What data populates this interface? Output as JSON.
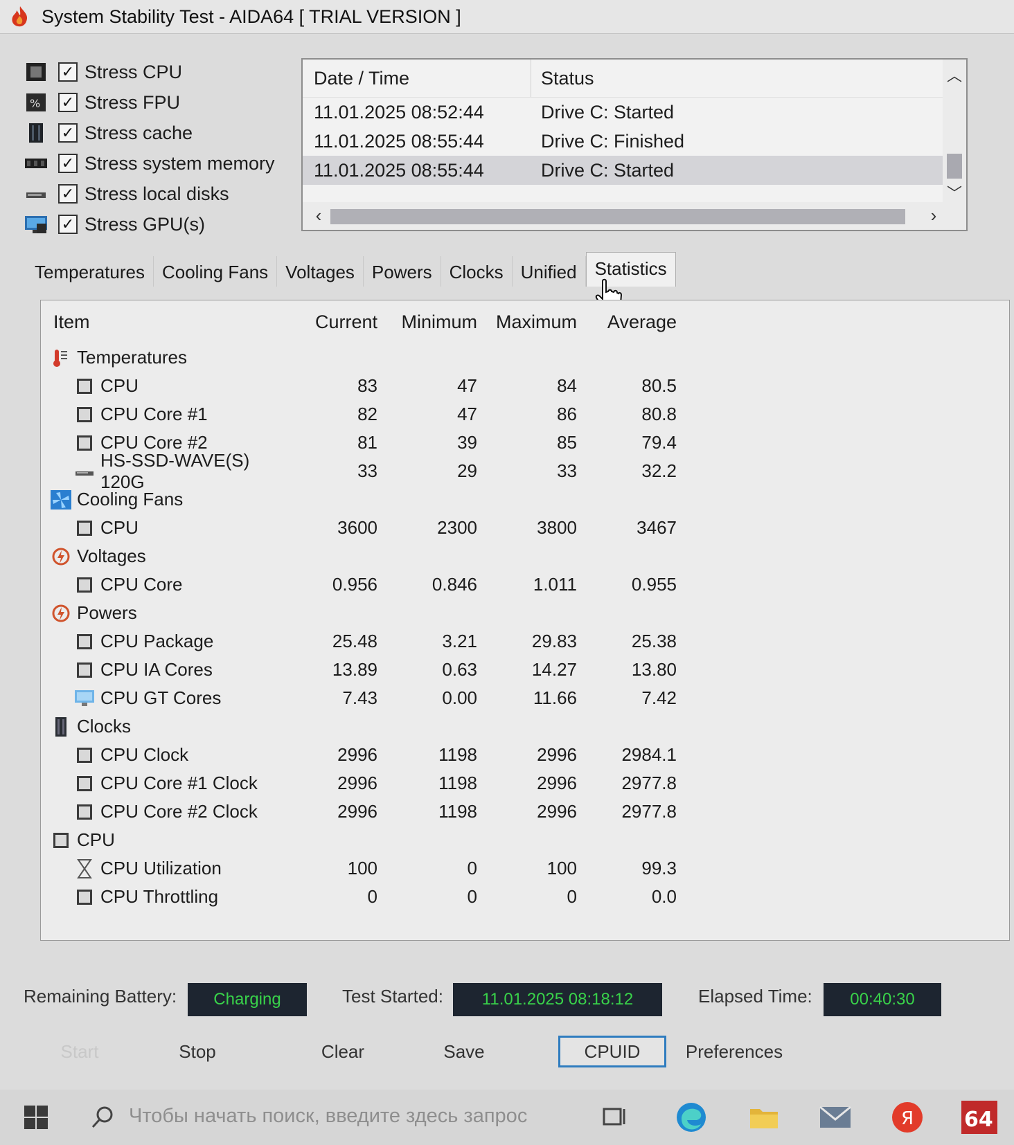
{
  "window": {
    "title": "System Stability Test - AIDA64  [ TRIAL VERSION ]"
  },
  "stress_options": [
    {
      "label": "Stress CPU",
      "checked": true,
      "icon": "cpu-chip-icon"
    },
    {
      "label": "Stress FPU",
      "checked": true,
      "icon": "fpu-icon"
    },
    {
      "label": "Stress cache",
      "checked": true,
      "icon": "cache-icon"
    },
    {
      "label": "Stress system memory",
      "checked": true,
      "icon": "memory-icon"
    },
    {
      "label": "Stress local disks",
      "checked": true,
      "icon": "disk-icon"
    },
    {
      "label": "Stress GPU(s)",
      "checked": true,
      "icon": "gpu-icon"
    }
  ],
  "log": {
    "columns": [
      "Date / Time",
      "Status"
    ],
    "rows": [
      {
        "time": "11.01.2025 08:52:44",
        "status": "Drive C: Started"
      },
      {
        "time": "11.01.2025 08:55:44",
        "status": "Drive C: Finished"
      },
      {
        "time": "11.01.2025 08:55:44",
        "status": "Drive C: Started"
      }
    ]
  },
  "tabs": [
    "Temperatures",
    "Cooling Fans",
    "Voltages",
    "Powers",
    "Clocks",
    "Unified",
    "Statistics"
  ],
  "active_tab": "Statistics",
  "stats": {
    "columns": [
      "Item",
      "Current",
      "Minimum",
      "Maximum",
      "Average"
    ],
    "groups": [
      {
        "name": "Temperatures",
        "icon": "thermometer-icon",
        "items": [
          {
            "name": "CPU",
            "icon": "chip-icon",
            "current": "83",
            "minimum": "47",
            "maximum": "84",
            "average": "80.5"
          },
          {
            "name": "CPU Core #1",
            "icon": "chip-icon",
            "current": "82",
            "minimum": "47",
            "maximum": "86",
            "average": "80.8"
          },
          {
            "name": "CPU Core #2",
            "icon": "chip-icon",
            "current": "81",
            "minimum": "39",
            "maximum": "85",
            "average": "79.4"
          },
          {
            "name": "HS-SSD-WAVE(S) 120G",
            "icon": "disk-icon",
            "current": "33",
            "minimum": "29",
            "maximum": "33",
            "average": "32.2"
          }
        ]
      },
      {
        "name": "Cooling Fans",
        "icon": "fan-icon",
        "items": [
          {
            "name": "CPU",
            "icon": "chip-icon",
            "current": "3600",
            "minimum": "2300",
            "maximum": "3800",
            "average": "3467"
          }
        ]
      },
      {
        "name": "Voltages",
        "icon": "voltage-icon",
        "items": [
          {
            "name": "CPU Core",
            "icon": "chip-icon",
            "current": "0.956",
            "minimum": "0.846",
            "maximum": "1.011",
            "average": "0.955"
          }
        ]
      },
      {
        "name": "Powers",
        "icon": "power-icon",
        "items": [
          {
            "name": "CPU Package",
            "icon": "chip-icon",
            "current": "25.48",
            "minimum": "3.21",
            "maximum": "29.83",
            "average": "25.38"
          },
          {
            "name": "CPU IA Cores",
            "icon": "chip-icon",
            "current": "13.89",
            "minimum": "0.63",
            "maximum": "14.27",
            "average": "13.80"
          },
          {
            "name": "CPU GT Cores",
            "icon": "monitor-icon",
            "current": "7.43",
            "minimum": "0.00",
            "maximum": "11.66",
            "average": "7.42"
          }
        ]
      },
      {
        "name": "Clocks",
        "icon": "clock-module-icon",
        "items": [
          {
            "name": "CPU Clock",
            "icon": "chip-icon",
            "current": "2996",
            "minimum": "1198",
            "maximum": "2996",
            "average": "2984.1"
          },
          {
            "name": "CPU Core #1 Clock",
            "icon": "chip-icon",
            "current": "2996",
            "minimum": "1198",
            "maximum": "2996",
            "average": "2977.8"
          },
          {
            "name": "CPU Core #2 Clock",
            "icon": "chip-icon",
            "current": "2996",
            "minimum": "1198",
            "maximum": "2996",
            "average": "2977.8"
          }
        ]
      },
      {
        "name": "CPU",
        "icon": "chip-icon",
        "items": [
          {
            "name": "CPU Utilization",
            "icon": "hourglass-icon",
            "current": "100",
            "minimum": "0",
            "maximum": "100",
            "average": "99.3"
          },
          {
            "name": "CPU Throttling",
            "icon": "chip-icon",
            "current": "0",
            "minimum": "0",
            "maximum": "0",
            "average": "0.0"
          }
        ]
      }
    ]
  },
  "status": {
    "battery_label": "Remaining Battery:",
    "battery_value": "Charging",
    "started_label": "Test Started:",
    "started_value": "11.01.2025 08:18:12",
    "elapsed_label": "Elapsed Time:",
    "elapsed_value": "00:40:30",
    "value_color": "#39d24a"
  },
  "buttons": {
    "start": "Start",
    "stop": "Stop",
    "clear": "Clear",
    "save": "Save",
    "cpuid": "CPUID",
    "preferences": "Preferences"
  },
  "taskbar": {
    "search_placeholder": "Чтобы начать поиск, введите здесь запрос",
    "aida_badge": "64",
    "yandex_badge": "Я"
  }
}
